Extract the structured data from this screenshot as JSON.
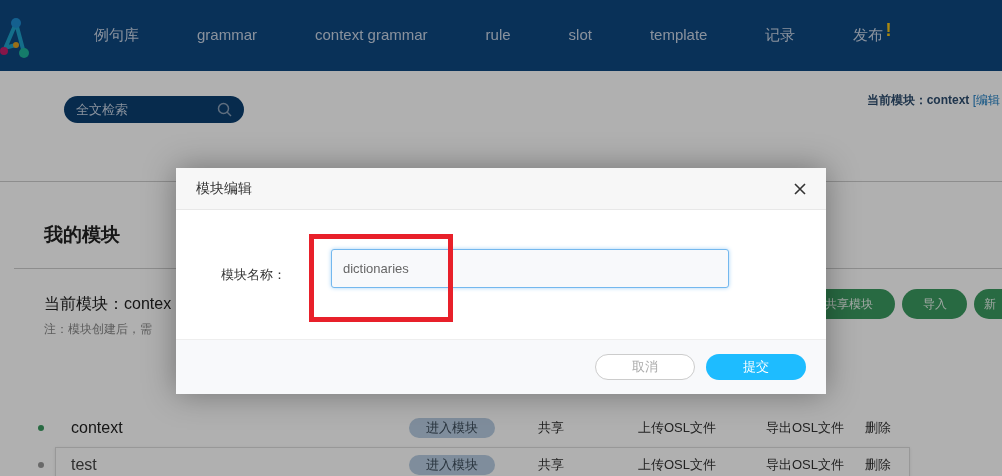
{
  "nav": {
    "items": [
      {
        "label": "例句库",
        "alert": false
      },
      {
        "label": "grammar",
        "alert": false
      },
      {
        "label": "context grammar",
        "alert": false
      },
      {
        "label": "rule",
        "alert": false
      },
      {
        "label": "slot",
        "alert": false
      },
      {
        "label": "template",
        "alert": false
      },
      {
        "label": "记录",
        "alert": false
      },
      {
        "label": "发布",
        "alert": true,
        "alert_mark": "!"
      }
    ]
  },
  "search": {
    "placeholder": "全文检索"
  },
  "current_module_top": {
    "label": "当前模块：context",
    "link": "[编辑"
  },
  "section": {
    "title": "我的模块",
    "current": "当前模块：contex",
    "note": "注：模块创建后，需",
    "buttons": [
      "共享模块",
      "导入",
      "新"
    ]
  },
  "modules": [
    {
      "name": "context",
      "active": true,
      "hovered": false,
      "actions": [
        "进入模块",
        "共享",
        "上传OSL文件",
        "导出OSL文件",
        "删除"
      ]
    },
    {
      "name": "test",
      "active": false,
      "hovered": true,
      "actions": [
        "进入模块",
        "共享",
        "上传OSL文件",
        "导出OSL文件",
        "删除"
      ]
    }
  ],
  "modal": {
    "title": "模块编辑",
    "field_label": "模块名称：",
    "field_value": "dictionaries",
    "highlighted": true,
    "buttons": [
      {
        "label": "取消",
        "kind": "secondary"
      },
      {
        "label": "提交",
        "kind": "primary"
      }
    ]
  }
}
